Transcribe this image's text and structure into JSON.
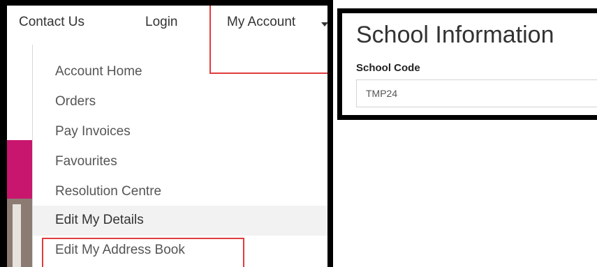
{
  "nav": {
    "contact_label": "Contact Us",
    "login_label": "Login",
    "account_label": "My Account"
  },
  "account_menu": {
    "items": [
      "Account Home",
      "Orders",
      "Pay Invoices",
      "Favourites",
      "Resolution Centre",
      "Edit My Details",
      "Edit My Address Book"
    ]
  },
  "school": {
    "title": "School Information",
    "code_label": "School Code",
    "code_value": "TMP24"
  },
  "colors": {
    "highlight": "#e03c3c",
    "accent_pink": "#c8166e"
  },
  "icons": {
    "dropdown_caret": "chevron-down-icon"
  }
}
